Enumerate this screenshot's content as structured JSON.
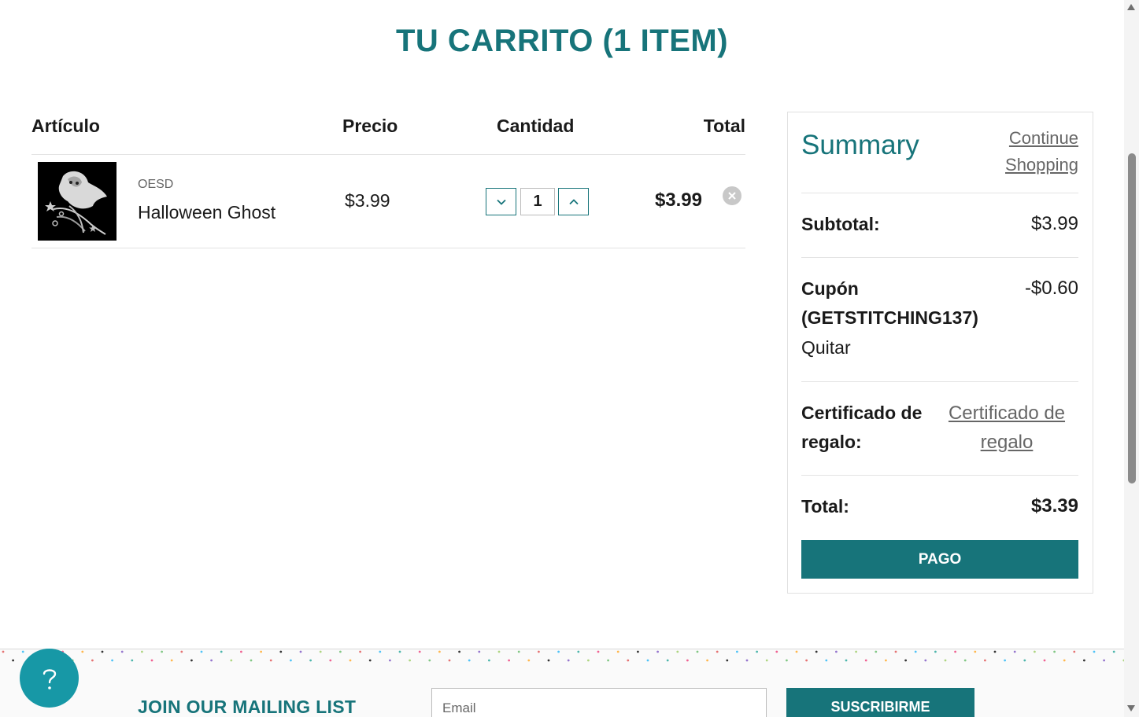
{
  "page": {
    "title": "TU CARRITO (1 ITEM)"
  },
  "cart": {
    "headers": {
      "item": "Artículo",
      "price": "Precio",
      "quantity": "Cantidad",
      "total": "Total"
    },
    "items": [
      {
        "brand": "OESD",
        "name": "Halloween Ghost",
        "price": "$3.99",
        "quantity": "1",
        "total": "$3.99"
      }
    ]
  },
  "summary": {
    "title": "Summary",
    "continue_shopping": "Continue Shopping",
    "subtotal_label": "Subtotal:",
    "subtotal_value": "$3.99",
    "coupon_label": "Cupón (GETSTITCHING137)",
    "coupon_value": "-$0.60",
    "coupon_remove": "Quitar",
    "gift_label": "Certificado de regalo:",
    "gift_link": "Certificado de regalo",
    "total_label": "Total:",
    "total_value": "$3.39",
    "checkout_button": "PAGO"
  },
  "footer": {
    "mailing_title": "JOIN OUR MAILING LIST",
    "email_placeholder": "Email",
    "subscribe_button": "SUSCRIBIRME"
  },
  "colors": {
    "brand": "#17747a",
    "help": "#1798a6"
  },
  "icons": [
    "chevron-down-icon",
    "chevron-up-icon",
    "close-icon",
    "help-icon"
  ]
}
